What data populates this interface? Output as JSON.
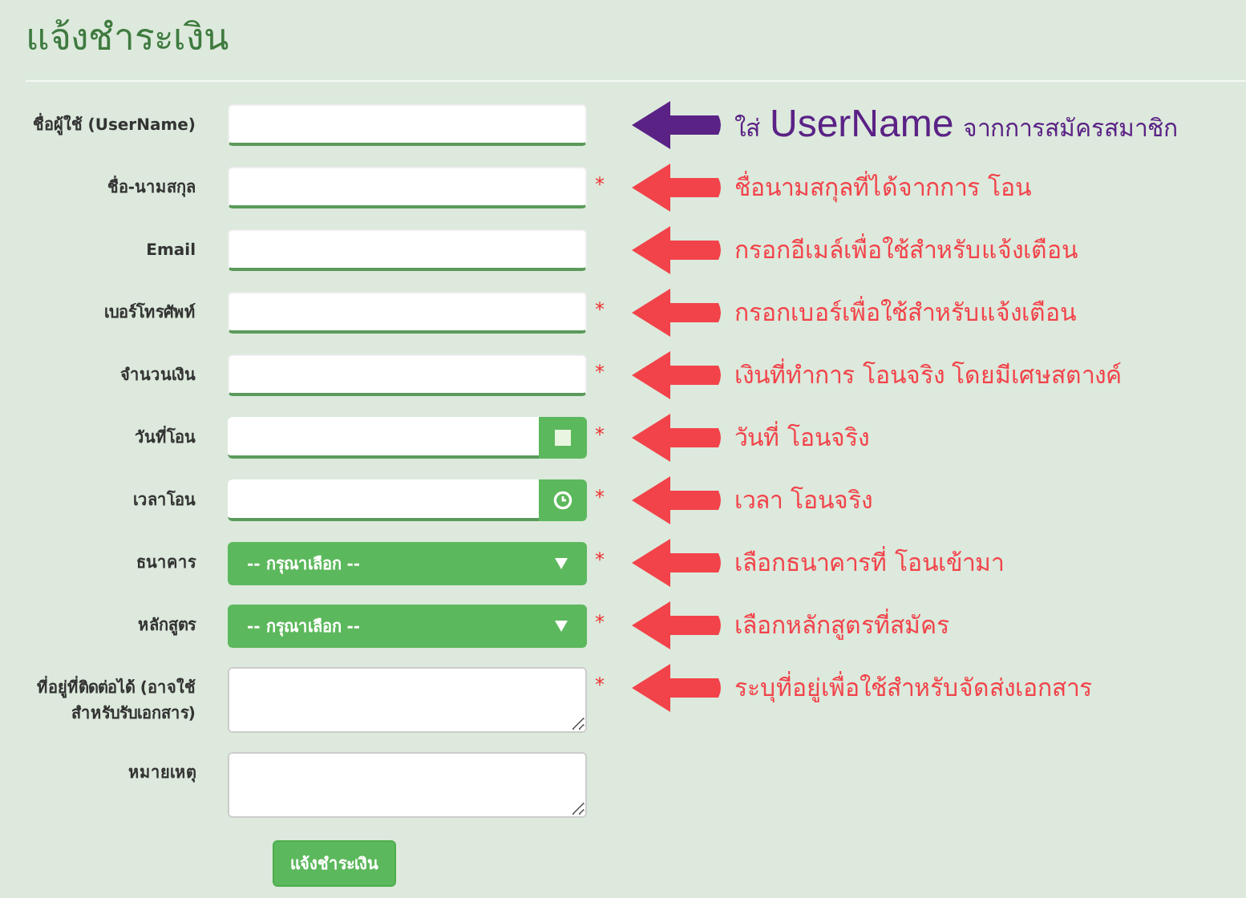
{
  "title": "แจ้งชำระเงิน",
  "fields": [
    {
      "kind": "text",
      "label": "ชื่อผู้ใช้ (UserName)",
      "annotation": {
        "color": "#5b2286",
        "text": "ใส่",
        "highlight": "UserName",
        "after": "จากการสมัครสมาชิก"
      }
    },
    {
      "kind": "text",
      "label": "ชื่อ-นามสกุล",
      "marker": "*",
      "annotation": {
        "color": "#f2434a",
        "text": "ชื่อนามสกุลที่ได้จากการ โอน"
      }
    },
    {
      "kind": "text",
      "label": "Email",
      "annotation": {
        "color": "#f2434a",
        "text": "กรอกอีเมล์เพื่อใช้สำหรับแจ้งเตือน"
      }
    },
    {
      "kind": "text",
      "label": "เบอร์โทรศัพท์",
      "marker": "*",
      "annotation": {
        "color": "#f2434a",
        "text": "กรอกเบอร์เพื่อใช้สำหรับแจ้งเตือน"
      }
    },
    {
      "kind": "text",
      "label": "จำนวนเงิน",
      "marker": "*",
      "annotation": {
        "color": "#f2434a",
        "text": "เงินที่ทำการ โอนจริง โดยมีเศษสตางค์"
      }
    },
    {
      "kind": "date",
      "label": "วันที่โอน",
      "marker": "*",
      "annotation": {
        "color": "#f2434a",
        "text": "วันที่ โอนจริง"
      }
    },
    {
      "kind": "time",
      "label": "เวลาโอน",
      "marker": "*",
      "annotation": {
        "color": "#f2434a",
        "text": "เวลา โอนจริง"
      }
    },
    {
      "kind": "select",
      "label": "ธนาคาร",
      "marker": "*",
      "value": "-- กรุณาเลือก --",
      "annotation": {
        "color": "#f2434a",
        "text": "เลือกธนาคารที่ โอนเข้ามา"
      }
    },
    {
      "kind": "select",
      "label": "หลักสูตร",
      "marker": "*",
      "value": "-- กรุณาเลือก --",
      "annotation": {
        "color": "#f2434a",
        "text": "เลือกหลักสูตรที่สมัคร"
      }
    },
    {
      "kind": "textarea",
      "label": "ที่อยู่ที่ติดต่อได้ (อาจใช้สำหรับรับเอกสาร)",
      "marker": "*",
      "annotation": {
        "color": "#f2434a",
        "text": "ระบุที่อยู่เพื่อใช้สำหรับจัดส่งเอกสาร"
      }
    },
    {
      "kind": "textarea",
      "label": "หมายเหตุ"
    }
  ],
  "submit": "แจ้งชำระเงิน"
}
